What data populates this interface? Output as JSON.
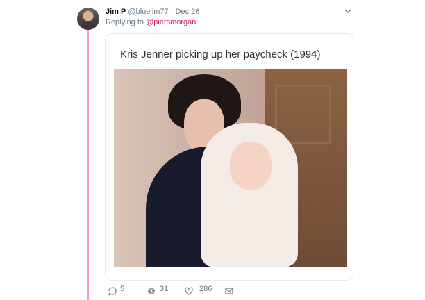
{
  "tweet": {
    "name": "Jim P",
    "handle": "@bluejim77",
    "separator": "·",
    "date": "Dec 26",
    "reply_prefix": "Replying to",
    "reply_user": "@piersmorgan",
    "card_title": "Kris Jenner picking up her paycheck (1994)"
  },
  "actions": {
    "replies": "5",
    "retweets": "31",
    "likes": "286"
  },
  "colors": {
    "thread_line": "#f6a0ad",
    "mention": "#e0245e",
    "secondary_text": "#657786"
  },
  "icons": {
    "reply": "reply-icon",
    "retweet": "retweet-icon",
    "like": "heart-icon",
    "message": "envelope-icon",
    "menu": "chevron-down-icon"
  }
}
